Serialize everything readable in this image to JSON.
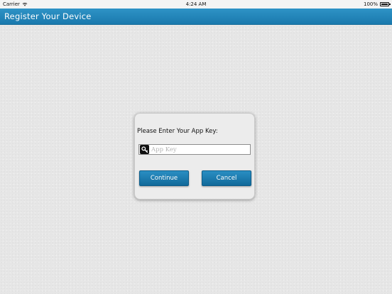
{
  "status_bar": {
    "carrier": "Carrier",
    "time": "4:24 AM",
    "battery": "100%"
  },
  "nav": {
    "title": "Register Your Device"
  },
  "dialog": {
    "prompt": "Please Enter Your App Key:",
    "app_key": {
      "placeholder": "App Key",
      "value": ""
    },
    "continue_label": "Continue",
    "cancel_label": "Cancel"
  },
  "colors": {
    "accent": "#1a79ad",
    "button": "#11699a",
    "background": "#e6e6e6"
  },
  "icons": {
    "wifi": "wifi-icon",
    "battery": "battery-icon",
    "key": "key-icon"
  }
}
